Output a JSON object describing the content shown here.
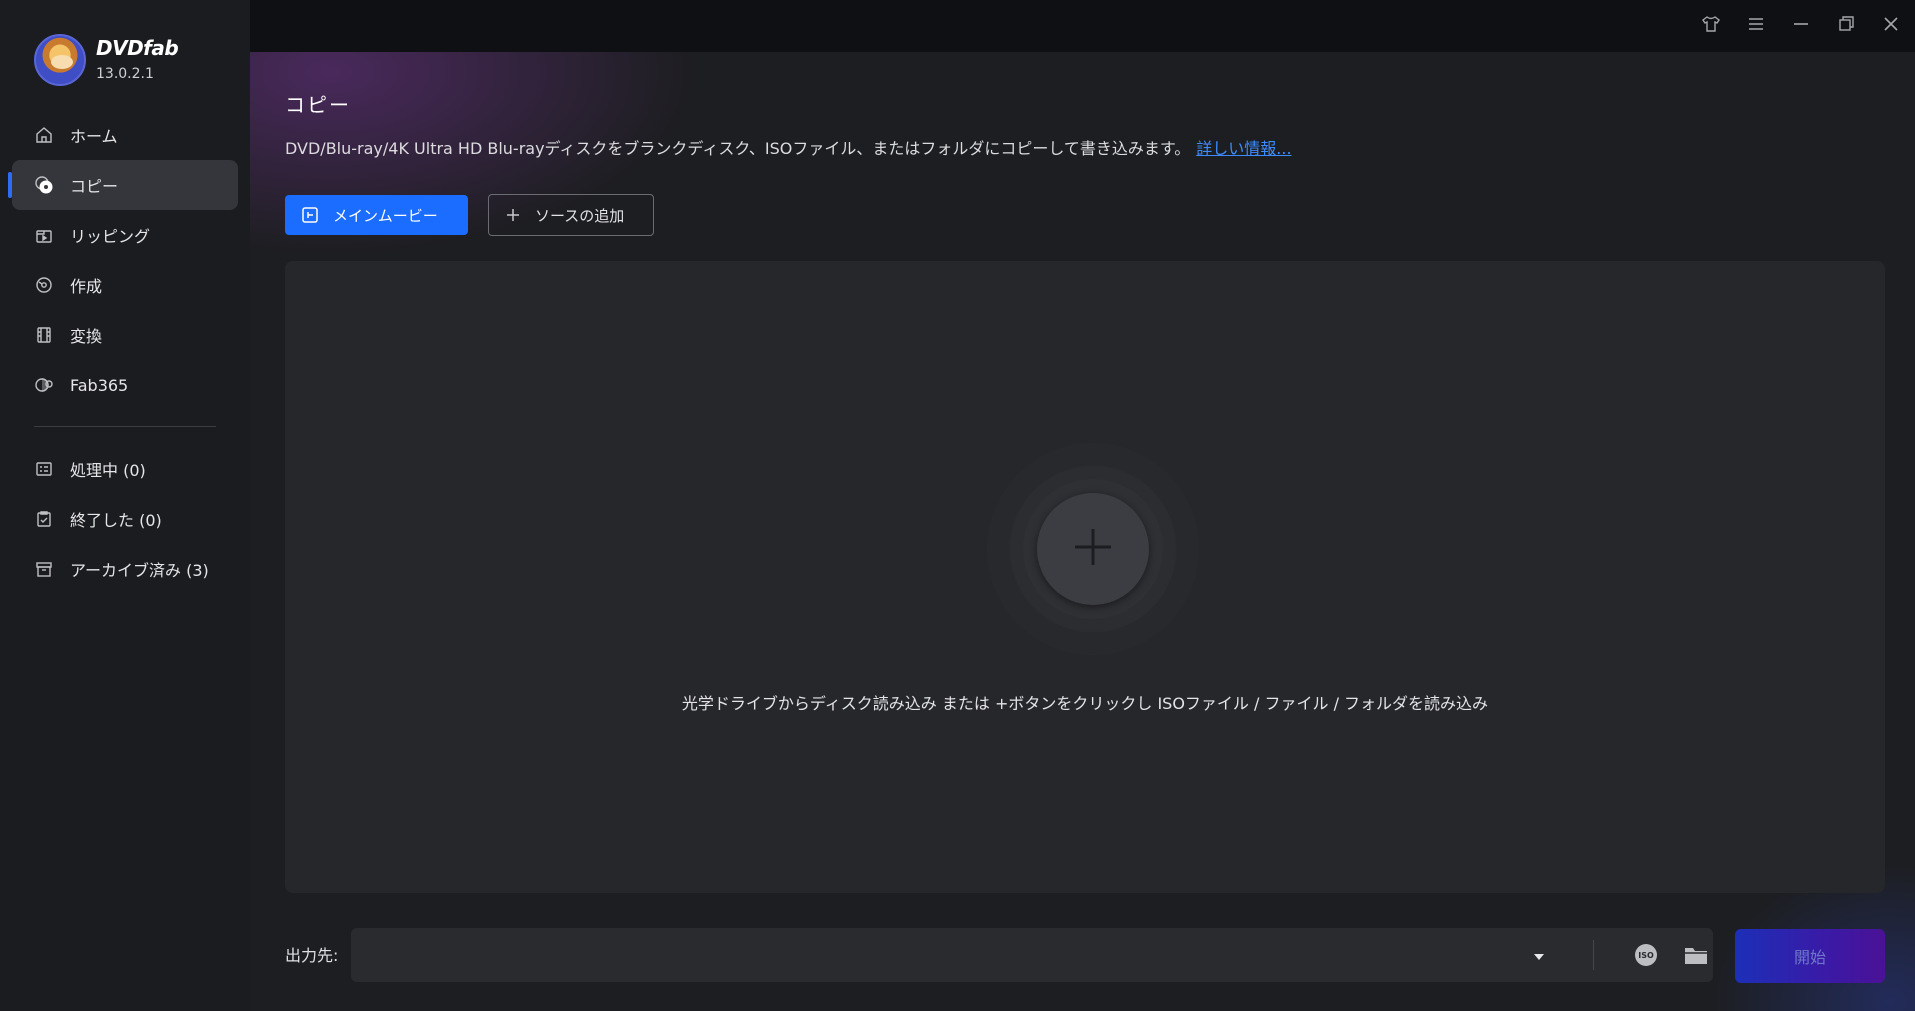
{
  "app": {
    "name": "DVDfab",
    "version": "13.0.2.1"
  },
  "sidebar": {
    "items": [
      {
        "label": "ホーム",
        "icon": "home-icon"
      },
      {
        "label": "コピー",
        "icon": "copy-disc-icon",
        "active": true
      },
      {
        "label": "リッピング",
        "icon": "ripper-icon"
      },
      {
        "label": "作成",
        "icon": "creator-icon"
      },
      {
        "label": "変換",
        "icon": "film-icon"
      },
      {
        "label": "Fab365",
        "icon": "fab365-icon"
      }
    ],
    "queue_items": [
      {
        "label": "処理中 (0)",
        "icon": "task-list-icon"
      },
      {
        "label": "終了した (0)",
        "icon": "clipboard-check-icon"
      },
      {
        "label": "アーカイブ済み (3)",
        "icon": "archive-icon"
      }
    ]
  },
  "titlebar": {
    "icons": [
      "shirt-skin-icon",
      "menu-icon",
      "minimize-icon",
      "restore-icon",
      "close-icon"
    ]
  },
  "main": {
    "title": "コピー",
    "description": "DVD/Blu-ray/4K Ultra HD Blu-rayディスクをブランクディスク、ISOファイル、またはフォルダにコピーして書き込みます。",
    "more_info_link": "詳しい情報...",
    "mode_button": "メインムービー",
    "add_source_button": "ソースの追加",
    "drop_hint": "光学ドライブからディスク読み込み または +ボタンをクリックし ISOファイル / ファイル / フォルダを読み込み",
    "output_label": "出力先:",
    "output_value": "",
    "start_button": "開始"
  },
  "colors": {
    "accent": "#1a6dff",
    "link": "#3d8cff",
    "sidebar_active": "#34363c"
  }
}
